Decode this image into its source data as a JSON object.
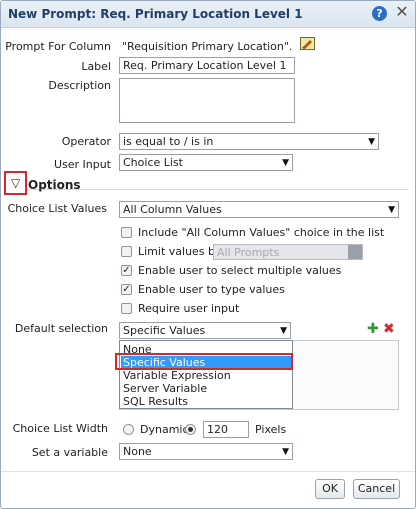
{
  "dialog": {
    "title": "New Prompt: Req. Primary Location Level 1",
    "help_icon": "?",
    "close_icon": "✕"
  },
  "fields": {
    "prompt_for_column_label": "Prompt For Column",
    "prompt_for_column_value": "\"Requisition Primary Location\".\"Rec",
    "label_label": "Label",
    "label_value": "Req. Primary Location Level 1",
    "description_label": "Description",
    "description_value": "",
    "operator_label": "Operator",
    "operator_value": "is equal to / is in",
    "user_input_label": "User Input",
    "user_input_value": "Choice List"
  },
  "options": {
    "toggle_glyph": "▽",
    "heading": "Options",
    "choice_list_values_label": "Choice List Values",
    "choice_list_values_value": "All Column Values",
    "checkboxes": [
      {
        "label": "Include \"All Column Values\" choice in the list",
        "checked": false
      },
      {
        "label": "Limit values by",
        "checked": false
      },
      {
        "label": "Enable user to select multiple values",
        "checked": true
      },
      {
        "label": "Enable user to type values",
        "checked": true
      },
      {
        "label": "Require user input",
        "checked": false
      }
    ],
    "limit_values_by_value": "All Prompts",
    "default_selection_label": "Default selection",
    "default_selection_value": "Specific Values",
    "dropdown_items": [
      "None",
      "Specific Values",
      "Variable Expression",
      "Server Variable",
      "SQL Results"
    ],
    "add_icon": "✚",
    "delete_icon": "✖",
    "choice_list_width_label": "Choice List Width",
    "dynamic_label": "Dynamic",
    "width_value": "120",
    "pixels_label": "Pixels",
    "set_variable_label": "Set a variable",
    "set_variable_value": "None"
  },
  "buttons": {
    "ok": "OK",
    "cancel": "Cancel"
  },
  "colors": {
    "highlight_red": "#d9262a",
    "selected_blue": "#3399ff",
    "title_blue": "#1f3f66"
  }
}
